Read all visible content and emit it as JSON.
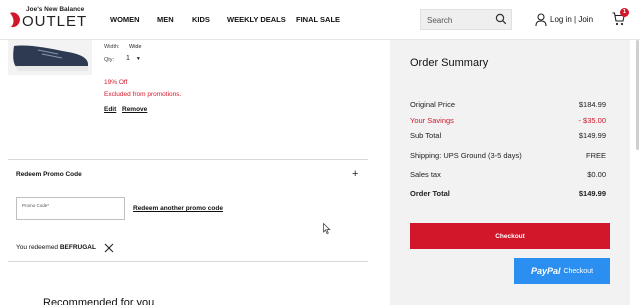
{
  "header": {
    "logo_top": "Joe's New Balance",
    "logo_bottom": "OUTLET",
    "nav": [
      "WOMEN",
      "MEN",
      "KIDS",
      "WEEKLY DEALS",
      "FINAL SALE"
    ],
    "search_placeholder": "Search",
    "login_label": "Log in",
    "separator": "|",
    "join_label": "Join",
    "cart_count": "1"
  },
  "product": {
    "width_label": "Width:",
    "width_value": "Wide",
    "qty_label": "Qty:",
    "qty_value": "1",
    "discount": "19% Off",
    "excluded": "Excluded from promotions.",
    "edit": "Edit",
    "remove": "Remove"
  },
  "promo": {
    "title": "Redeem Promo Code",
    "plus": "+",
    "input_placeholder": "Promo Code",
    "required_mark": "*",
    "redeem_another": "Redeem another promo code",
    "redeemed_text": "You redeemed",
    "redeemed_code": "BEFRUGAL"
  },
  "recommended_title": "Recommended for you",
  "summary": {
    "title": "Order Summary",
    "rows": [
      {
        "label": "Original Price",
        "value": "$184.99"
      },
      {
        "label": "Your Savings",
        "value": "- $35.00"
      },
      {
        "label": "Sub Total",
        "value": "$149.99"
      },
      {
        "label": "Shipping: UPS Ground (3-5 days)",
        "value": "FREE"
      },
      {
        "label": "Sales tax",
        "value": "$0.00"
      },
      {
        "label": "Order Total",
        "value": "$149.99"
      }
    ],
    "checkout": "Checkout",
    "paypal_logo": "PayPal",
    "paypal_text": "Checkout"
  },
  "colors": {
    "accent_red": "#d3172b",
    "paypal_blue": "#2a8ff0",
    "summary_bg": "#f2f2f2"
  }
}
